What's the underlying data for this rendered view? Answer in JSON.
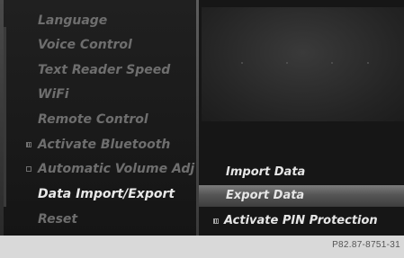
{
  "left_menu": {
    "items": [
      {
        "label": "Language"
      },
      {
        "label": "Voice Control"
      },
      {
        "label": "Text Reader Speed"
      },
      {
        "label": "WiFi"
      },
      {
        "label": "Remote Control"
      },
      {
        "label": "Activate Bluetooth"
      },
      {
        "label": "Automatic Volume Adj"
      },
      {
        "label": "Data Import/Export"
      },
      {
        "label": "Reset"
      }
    ]
  },
  "right_menu": {
    "items": [
      {
        "label": "Import Data"
      },
      {
        "label": "Export Data"
      },
      {
        "label": "Activate PIN Protection"
      }
    ]
  },
  "footer": {
    "code": "P82.87-8751-31"
  }
}
